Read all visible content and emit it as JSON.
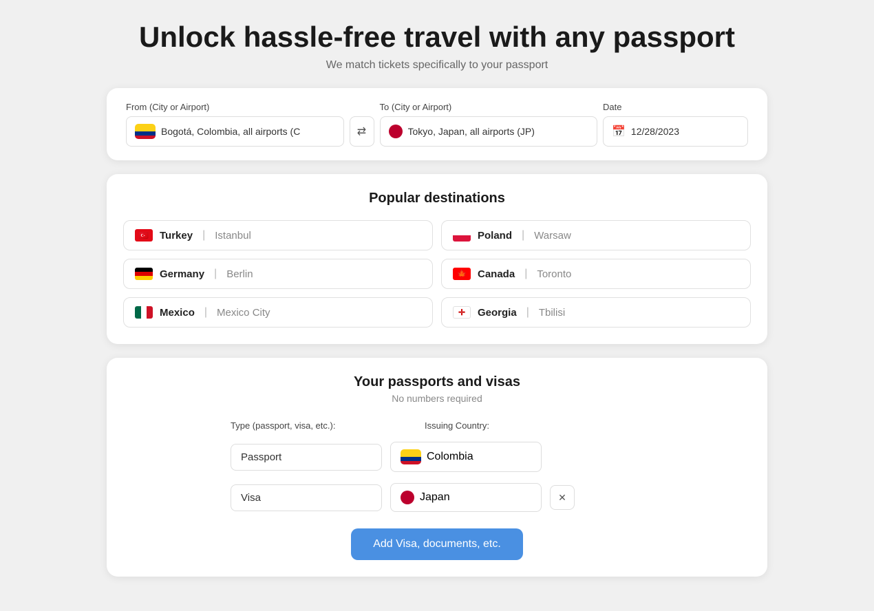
{
  "hero": {
    "title": "Unlock hassle-free travel with any passport",
    "subtitle": "We match tickets specifically to your passport"
  },
  "search": {
    "from_label": "From (City or Airport)",
    "from_value": "Bogotá, Colombia, all airports (C",
    "to_label": "To (City or Airport)",
    "to_value": "Tokyo, Japan, all airports (JP)",
    "date_label": "Date",
    "date_value": "12/28/2023",
    "swap_label": "⇄"
  },
  "popular": {
    "title": "Popular destinations",
    "items": [
      {
        "country": "Turkey",
        "city": "Istanbul",
        "flag_type": "turkey"
      },
      {
        "country": "Poland",
        "city": "Warsaw",
        "flag_type": "poland"
      },
      {
        "country": "Germany",
        "city": "Berlin",
        "flag_type": "germany"
      },
      {
        "country": "Canada",
        "city": "Toronto",
        "flag_type": "canada"
      },
      {
        "country": "Mexico",
        "city": "Mexico City",
        "flag_type": "mexico"
      },
      {
        "country": "Georgia",
        "city": "Tbilisi",
        "flag_type": "georgia"
      }
    ]
  },
  "passports": {
    "title": "Your passports and visas",
    "subtitle": "No numbers required",
    "type_label": "Type (passport, visa, etc.):",
    "country_label": "Issuing Country:",
    "rows": [
      {
        "type": "Passport",
        "country": "Colombia",
        "flag_type": "colombia",
        "deletable": false
      },
      {
        "type": "Visa",
        "country": "Japan",
        "flag_type": "japan",
        "deletable": true
      }
    ],
    "add_button": "Add Visa, documents, etc."
  }
}
